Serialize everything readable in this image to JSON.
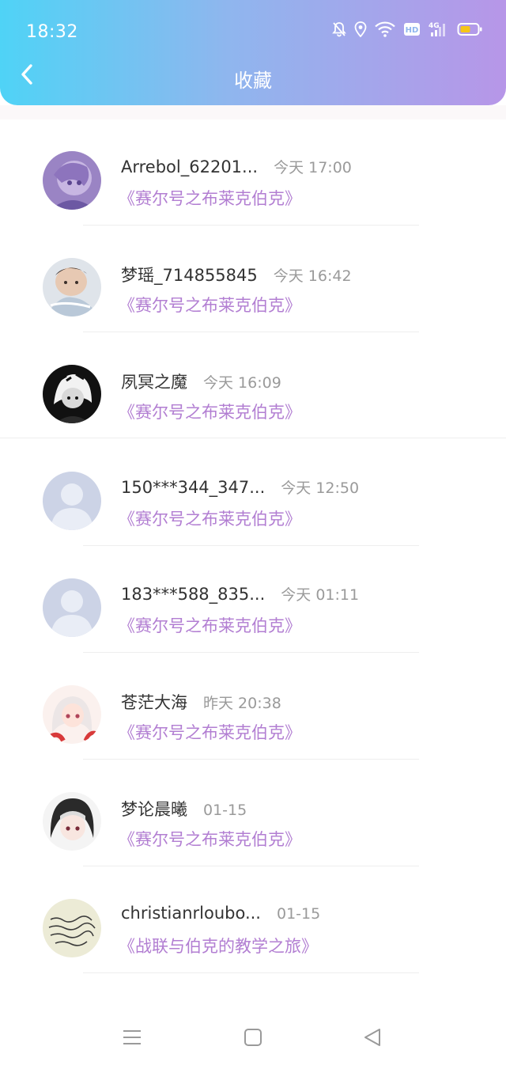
{
  "status_bar": {
    "time": "18:32",
    "icons": [
      "mute-bell-icon",
      "location-pin-icon",
      "wifi-icon",
      "hd-icon",
      "4g-signal-icon",
      "battery-icon"
    ],
    "hd_label": "HD",
    "network_label": "4G"
  },
  "header": {
    "title": "收藏",
    "back_icon": "chevron-left-icon",
    "gradient_colors": [
      "#4fd3f6",
      "#8fb6ee",
      "#b796e8"
    ]
  },
  "favorites": [
    {
      "name": "Arrebol_62201...",
      "time": "今天 17:00",
      "book": "《赛尔号之布莱克伯克》",
      "avatar": "anime-purple"
    },
    {
      "name": "梦瑶_714855845",
      "time": "今天 16:42",
      "book": "《赛尔号之布莱克伯克》",
      "avatar": "baby-photo"
    },
    {
      "name": "夙冥之魔",
      "time": "今天 16:09",
      "book": "《赛尔号之布莱克伯克》",
      "avatar": "anime-dark"
    },
    {
      "name": "150***344_347...",
      "time": "今天 12:50",
      "book": "《赛尔号之布莱克伯克》",
      "avatar": "default-person"
    },
    {
      "name": "183***588_835...",
      "time": "今天 01:11",
      "book": "《赛尔号之布莱克伯克》",
      "avatar": "default-person"
    },
    {
      "name": "苍茫大海",
      "time": "昨天 20:38",
      "book": "《赛尔号之布莱克伯克》",
      "avatar": "anime-red"
    },
    {
      "name": "梦论晨曦",
      "time": "01-15",
      "book": "《赛尔号之布莱克伯克》",
      "avatar": "anime-hood"
    },
    {
      "name": "christianrloubo...",
      "time": "01-15",
      "book": "《战联与伯克的教学之旅》",
      "avatar": "handwriting"
    }
  ],
  "colors": {
    "book_title": "#b27ed2",
    "name": "#333333",
    "time": "#9a9a9a"
  },
  "nav_bar": {
    "icons": [
      "menu-icon",
      "home-square-icon",
      "back-triangle-icon"
    ]
  }
}
